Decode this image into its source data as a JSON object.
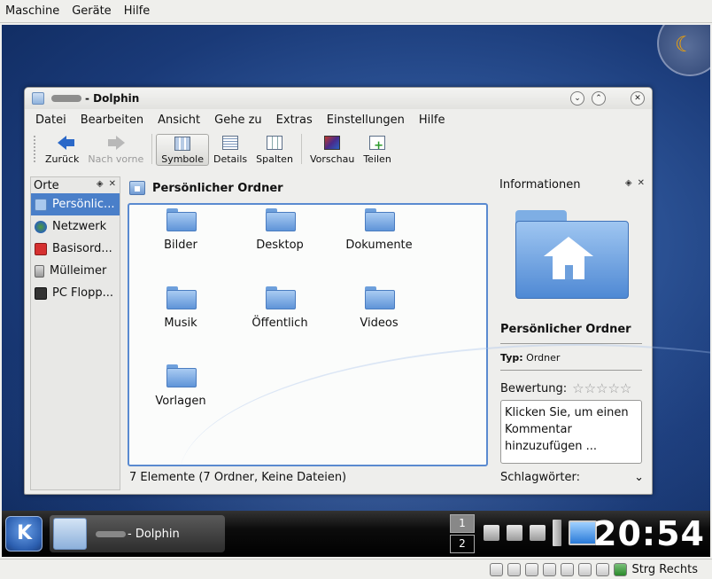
{
  "host": {
    "menu": [
      "Maschine",
      "Geräte",
      "Hilfe"
    ],
    "host_key_label": "Strg Rechts"
  },
  "window": {
    "title": "- Dolphin",
    "menu": [
      "Datei",
      "Bearbeiten",
      "Ansicht",
      "Gehe zu",
      "Extras",
      "Einstellungen",
      "Hilfe"
    ],
    "toolbar": {
      "back": "Zurück",
      "forward": "Nach vorne",
      "icons": "Symbole",
      "details": "Details",
      "columns": "Spalten",
      "preview": "Vorschau",
      "split": "Teilen"
    }
  },
  "places": {
    "title": "Orte",
    "items": [
      "Persönlic...",
      "Netzwerk",
      "Basisord...",
      "Mülleimer",
      "PC Flopp..."
    ]
  },
  "main": {
    "breadcrumb": "Persönlicher Ordner",
    "files": [
      "Bilder",
      "Desktop",
      "Dokumente",
      "Musik",
      "Öffentlich",
      "Videos",
      "Vorlagen"
    ],
    "status": "7 Elemente (7 Ordner, Keine Dateien)"
  },
  "info": {
    "title": "Informationen",
    "name": "Persönlicher Ordner",
    "type_label": "Typ:",
    "type_value": "Ordner",
    "rating_label": "Bewertung:",
    "rating_stars": 0,
    "comment_placeholder": "Klicken Sie, um einen Kommentar hinzuzufügen ...",
    "tags_label": "Schlagwörter:"
  },
  "taskbar": {
    "task_label": "- Dolphin",
    "pager": [
      "1",
      "2"
    ],
    "clock": "20:54"
  }
}
